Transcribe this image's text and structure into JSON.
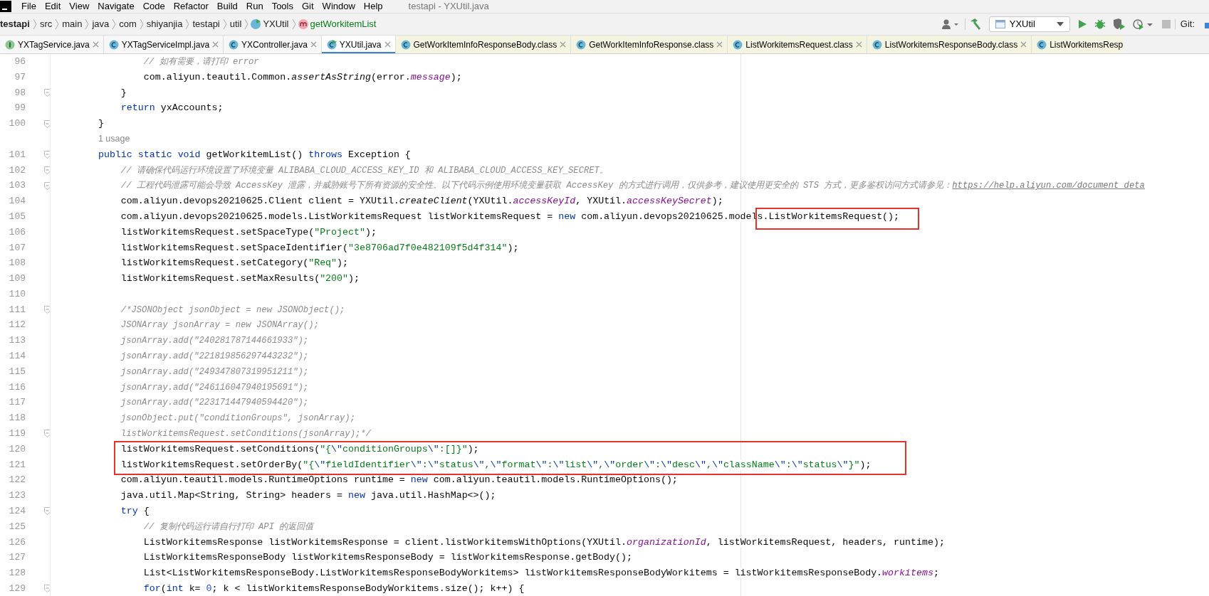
{
  "window": {
    "title": "testapi - YXUtil.java"
  },
  "menu": [
    "File",
    "Edit",
    "View",
    "Navigate",
    "Code",
    "Refactor",
    "Build",
    "Run",
    "Tools",
    "Git",
    "Window",
    "Help"
  ],
  "breadcrumbs": [
    {
      "label": "testapi",
      "kind": "project"
    },
    {
      "label": "src",
      "kind": "folder"
    },
    {
      "label": "main",
      "kind": "folder"
    },
    {
      "label": "java",
      "kind": "folder"
    },
    {
      "label": "com",
      "kind": "folder"
    },
    {
      "label": "shiyanjia",
      "kind": "folder"
    },
    {
      "label": "testapi",
      "kind": "folder"
    },
    {
      "label": "util",
      "kind": "folder"
    },
    {
      "label": "YXUtil",
      "kind": "class"
    },
    {
      "label": "getWorkitemList",
      "kind": "method"
    }
  ],
  "toolbar": [
    {
      "kind": "user-menu"
    },
    {
      "kind": "build"
    },
    {
      "kind": "run-config",
      "label": "YXUtil"
    },
    {
      "kind": "run"
    },
    {
      "kind": "debug"
    },
    {
      "kind": "coverage"
    },
    {
      "kind": "profile"
    },
    {
      "kind": "stop"
    },
    {
      "kind": "label",
      "label": "Git:"
    },
    {
      "kind": "git-update"
    }
  ],
  "tabs": [
    {
      "label": "YXTagService.java",
      "kind": "interface",
      "library": false,
      "selected": false,
      "closable": true
    },
    {
      "label": "YXTagServiceImpl.java",
      "kind": "class",
      "library": false,
      "selected": false,
      "closable": true
    },
    {
      "label": "YXController.java",
      "kind": "class",
      "library": false,
      "selected": false,
      "closable": true
    },
    {
      "label": "YXUtil.java",
      "kind": "runnable-class",
      "library": false,
      "selected": true,
      "closable": true
    },
    {
      "label": "GetWorkItemInfoResponseBody.class",
      "kind": "class",
      "library": true,
      "selected": false,
      "closable": true
    },
    {
      "label": "GetWorkItemInfoResponse.class",
      "kind": "class",
      "library": true,
      "selected": false,
      "closable": true
    },
    {
      "label": "ListWorkitemsRequest.class",
      "kind": "class",
      "library": true,
      "selected": false,
      "closable": true
    },
    {
      "label": "ListWorkitemsResponseBody.class",
      "kind": "class",
      "library": true,
      "selected": false,
      "closable": true
    },
    {
      "label": "ListWorkitemsResp",
      "kind": "class",
      "library": true,
      "selected": false,
      "closable": false
    }
  ],
  "editor": {
    "lines": [
      {
        "kind": "code",
        "number": "96",
        "fold": false,
        "boxed": false,
        "tokens": [
          {
            "kind": "comment",
            "text": "            // 如有需要，请打印 error"
          }
        ]
      },
      {
        "kind": "code",
        "number": "97",
        "fold": false,
        "boxed": false,
        "tokens": [
          {
            "kind": "plain",
            "text": "            com.aliyun.teautil.Common."
          },
          {
            "kind": "static-call",
            "text": "assertAsString"
          },
          {
            "kind": "plain",
            "text": "(error."
          },
          {
            "kind": "field",
            "text": "message"
          },
          {
            "kind": "plain",
            "text": ");"
          }
        ]
      },
      {
        "kind": "code",
        "number": "98",
        "fold": true,
        "boxed": false,
        "tokens": [
          {
            "kind": "plain",
            "text": "        }"
          }
        ]
      },
      {
        "kind": "code",
        "number": "99",
        "fold": false,
        "boxed": false,
        "tokens": [
          {
            "kind": "keyword",
            "text": "        return"
          },
          {
            "kind": "plain",
            "text": " yxAccounts;"
          }
        ]
      },
      {
        "kind": "code",
        "number": "100",
        "fold": true,
        "boxed": false,
        "tokens": [
          {
            "kind": "plain",
            "text": "    }"
          }
        ]
      },
      {
        "kind": "hint",
        "text": "    1 usage"
      },
      {
        "kind": "code",
        "number": "101",
        "fold": true,
        "boxed": false,
        "tokens": [
          {
            "kind": "keyword",
            "text": "    public static void"
          },
          {
            "kind": "plain",
            "text": " getWorkitemList() "
          },
          {
            "kind": "keyword",
            "text": "throws"
          },
          {
            "kind": "plain",
            "text": " Exception {"
          }
        ]
      },
      {
        "kind": "code",
        "number": "102",
        "fold": true,
        "boxed": false,
        "tokens": [
          {
            "kind": "comment",
            "text": "        // 请确保代码运行环境设置了环境变量 ALIBABA_CLOUD_ACCESS_KEY_ID 和 ALIBABA_CLOUD_ACCESS_KEY_SECRET。"
          }
        ]
      },
      {
        "kind": "code",
        "number": "103",
        "fold": true,
        "boxed": false,
        "tokens": [
          {
            "kind": "comment",
            "text": "        // 工程代码泄露可能会导致 AccessKey 泄露，并威胁账号下所有资源的安全性。以下代码示例使用环境变量获取 AccessKey 的方式进行调用，仅供参考，建议使用更安全的 STS 方式，更多鉴权访问方式请参见："
          },
          {
            "kind": "link",
            "text": "https://help.aliyun.com/document_deta"
          }
        ]
      },
      {
        "kind": "code",
        "number": "104",
        "fold": false,
        "boxed": false,
        "tokens": [
          {
            "kind": "plain",
            "text": "        com.aliyun.devops20210625.Client client = YXUtil."
          },
          {
            "kind": "static-call",
            "text": "createClient"
          },
          {
            "kind": "plain",
            "text": "(YXUtil."
          },
          {
            "kind": "field",
            "text": "accessKeyId"
          },
          {
            "kind": "plain",
            "text": ", YXUtil."
          },
          {
            "kind": "field",
            "text": "accessKeySecret"
          },
          {
            "kind": "plain",
            "text": ");"
          }
        ]
      },
      {
        "kind": "code",
        "number": "105",
        "fold": false,
        "boxed": false,
        "tokens": [
          {
            "kind": "plain",
            "text": "        com.aliyun.devops20210625.models.ListWorkitemsRequest listWorkitemsRequest = ",
            "boxed": false
          },
          {
            "kind": "keyword",
            "text": "new",
            "boxed": false
          },
          {
            "kind": "plain",
            "text": " com.aliyun.devops20210625.model",
            "boxed": false
          },
          {
            "kind": "plain",
            "text": "s.ListWorkitemsRequest();",
            "boxed": true
          }
        ]
      },
      {
        "kind": "code",
        "number": "106",
        "fold": false,
        "boxed": false,
        "tokens": [
          {
            "kind": "plain",
            "text": "        listWorkitemsRequest.setSpaceType("
          },
          {
            "kind": "string",
            "text": "\"Project\""
          },
          {
            "kind": "plain",
            "text": ");"
          }
        ]
      },
      {
        "kind": "code",
        "number": "107",
        "fold": false,
        "boxed": false,
        "tokens": [
          {
            "kind": "plain",
            "text": "        listWorkitemsRequest.setSpaceIdentifier("
          },
          {
            "kind": "string",
            "text": "\"3e8706ad7f0e482109f5d4f314\""
          },
          {
            "kind": "plain",
            "text": ");"
          }
        ]
      },
      {
        "kind": "code",
        "number": "108",
        "fold": false,
        "boxed": false,
        "tokens": [
          {
            "kind": "plain",
            "text": "        listWorkitemsRequest.setCategory("
          },
          {
            "kind": "string",
            "text": "\"Req\""
          },
          {
            "kind": "plain",
            "text": ");"
          }
        ]
      },
      {
        "kind": "code",
        "number": "109",
        "fold": false,
        "boxed": false,
        "tokens": [
          {
            "kind": "plain",
            "text": "        listWorkitemsRequest.setMaxResults("
          },
          {
            "kind": "string",
            "text": "\"200\""
          },
          {
            "kind": "plain",
            "text": ");"
          }
        ]
      },
      {
        "kind": "code",
        "number": "110",
        "fold": false,
        "boxed": false
      },
      {
        "kind": "code",
        "number": "111",
        "fold": true,
        "boxed": false,
        "tokens": [
          {
            "kind": "comment",
            "text": "        /*JSONObject jsonObject = new JSONObject();"
          }
        ]
      },
      {
        "kind": "code",
        "number": "112",
        "fold": false,
        "boxed": false,
        "tokens": [
          {
            "kind": "comment",
            "text": "        JSONArray jsonArray = new JSONArray();"
          }
        ]
      },
      {
        "kind": "code",
        "number": "113",
        "fold": false,
        "boxed": false,
        "tokens": [
          {
            "kind": "comment",
            "text": "        jsonArray.add(\"240281787144661933\");"
          }
        ]
      },
      {
        "kind": "code",
        "number": "114",
        "fold": false,
        "boxed": false,
        "tokens": [
          {
            "kind": "comment",
            "text": "        jsonArray.add(\"221819856297443232\");"
          }
        ]
      },
      {
        "kind": "code",
        "number": "115",
        "fold": false,
        "boxed": false,
        "tokens": [
          {
            "kind": "comment",
            "text": "        jsonArray.add(\"249347807319951211\");"
          }
        ]
      },
      {
        "kind": "code",
        "number": "116",
        "fold": false,
        "boxed": false,
        "tokens": [
          {
            "kind": "comment",
            "text": "        jsonArray.add(\"246116047940195691\");"
          }
        ]
      },
      {
        "kind": "code",
        "number": "117",
        "fold": false,
        "boxed": false,
        "tokens": [
          {
            "kind": "comment",
            "text": "        jsonArray.add(\"223171447940594420\");"
          }
        ]
      },
      {
        "kind": "code",
        "number": "118",
        "fold": false,
        "boxed": false,
        "tokens": [
          {
            "kind": "comment",
            "text": "        jsonObject.put(\"conditionGroups\", jsonArray);"
          }
        ]
      },
      {
        "kind": "code",
        "number": "119",
        "fold": true,
        "boxed": false,
        "tokens": [
          {
            "kind": "comment",
            "text": "        listWorkitemsRequest.setConditions(jsonArray);*/"
          }
        ]
      },
      {
        "kind": "code",
        "number": "120",
        "fold": false,
        "boxed": true,
        "tokens": [
          {
            "kind": "plain",
            "text": "        listWorkitemsRequest.setConditions("
          },
          {
            "kind": "string",
            "text": "\"{"
          },
          {
            "kind": "escape",
            "text": "\\\""
          },
          {
            "kind": "string",
            "text": "conditionGroups"
          },
          {
            "kind": "escape",
            "text": "\\\""
          },
          {
            "kind": "string",
            "text": ":[]}\""
          },
          {
            "kind": "plain",
            "text": ");"
          }
        ]
      },
      {
        "kind": "code",
        "number": "121",
        "fold": false,
        "boxed": true,
        "tokens": [
          {
            "kind": "plain",
            "text": "        listWorkitemsRequest.setOrderBy("
          },
          {
            "kind": "string",
            "text": "\"{"
          },
          {
            "kind": "escape",
            "text": "\\\""
          },
          {
            "kind": "string",
            "text": "fieldIdentifier"
          },
          {
            "kind": "escape",
            "text": "\\\""
          },
          {
            "kind": "string",
            "text": ":"
          },
          {
            "kind": "escape",
            "text": "\\\""
          },
          {
            "kind": "string",
            "text": "status"
          },
          {
            "kind": "escape",
            "text": "\\\""
          },
          {
            "kind": "string",
            "text": ","
          },
          {
            "kind": "escape",
            "text": "\\\""
          },
          {
            "kind": "string",
            "text": "format"
          },
          {
            "kind": "escape",
            "text": "\\\""
          },
          {
            "kind": "string",
            "text": ":"
          },
          {
            "kind": "escape",
            "text": "\\\""
          },
          {
            "kind": "string",
            "text": "list"
          },
          {
            "kind": "escape",
            "text": "\\\""
          },
          {
            "kind": "string",
            "text": ","
          },
          {
            "kind": "escape",
            "text": "\\\""
          },
          {
            "kind": "string",
            "text": "order"
          },
          {
            "kind": "escape",
            "text": "\\\""
          },
          {
            "kind": "string",
            "text": ":"
          },
          {
            "kind": "escape",
            "text": "\\\""
          },
          {
            "kind": "string",
            "text": "desc"
          },
          {
            "kind": "escape",
            "text": "\\\""
          },
          {
            "kind": "string",
            "text": ","
          },
          {
            "kind": "escape",
            "text": "\\\""
          },
          {
            "kind": "string",
            "text": "className"
          },
          {
            "kind": "escape",
            "text": "\\\""
          },
          {
            "kind": "string",
            "text": ":"
          },
          {
            "kind": "escape",
            "text": "\\\""
          },
          {
            "kind": "string",
            "text": "status"
          },
          {
            "kind": "escape",
            "text": "\\\""
          },
          {
            "kind": "string",
            "text": "}\""
          },
          {
            "kind": "plain",
            "text": ");"
          }
        ]
      },
      {
        "kind": "code",
        "number": "122",
        "fold": false,
        "boxed": false,
        "tokens": [
          {
            "kind": "plain",
            "text": "        com.aliyun.teautil.models.RuntimeOptions runtime = "
          },
          {
            "kind": "keyword",
            "text": "new"
          },
          {
            "kind": "plain",
            "text": " com.aliyun.teautil.models.RuntimeOptions();"
          }
        ]
      },
      {
        "kind": "code",
        "number": "123",
        "fold": false,
        "boxed": false,
        "tokens": [
          {
            "kind": "plain",
            "text": "        java.util.Map<String, String> headers = "
          },
          {
            "kind": "keyword",
            "text": "new"
          },
          {
            "kind": "plain",
            "text": " java.util.HashMap<>();"
          }
        ]
      },
      {
        "kind": "code",
        "number": "124",
        "fold": true,
        "boxed": false,
        "tokens": [
          {
            "kind": "keyword",
            "text": "        try"
          },
          {
            "kind": "plain",
            "text": " {"
          }
        ]
      },
      {
        "kind": "code",
        "number": "125",
        "fold": false,
        "boxed": false,
        "tokens": [
          {
            "kind": "comment",
            "text": "            // 复制代码运行请自行打印 API 的返回值"
          }
        ]
      },
      {
        "kind": "code",
        "number": "126",
        "fold": false,
        "boxed": false,
        "tokens": [
          {
            "kind": "plain",
            "text": "            ListWorkitemsResponse listWorkitemsResponse = client.listWorkitemsWithOptions(YXUtil."
          },
          {
            "kind": "field",
            "text": "organizationId"
          },
          {
            "kind": "plain",
            "text": ", listWorkitemsRequest, headers, runtime);"
          }
        ]
      },
      {
        "kind": "code",
        "number": "127",
        "fold": false,
        "boxed": false,
        "tokens": [
          {
            "kind": "plain",
            "text": "            ListWorkitemsResponseBody listWorkitemsResponseBody = listWorkitemsResponse.getBody();"
          }
        ]
      },
      {
        "kind": "code",
        "number": "128",
        "fold": false,
        "boxed": false,
        "tokens": [
          {
            "kind": "plain",
            "text": "            List<ListWorkitemsResponseBody.ListWorkitemsResponseBodyWorkitems> listWorkitemsResponseBodyWorkitems = listWorkitemsResponseBody."
          },
          {
            "kind": "field",
            "text": "workitems"
          },
          {
            "kind": "plain",
            "text": ";"
          }
        ]
      },
      {
        "kind": "code",
        "number": "129",
        "fold": true,
        "boxed": false,
        "tokens": [
          {
            "kind": "keyword",
            "text": "            for"
          },
          {
            "kind": "plain",
            "text": "("
          },
          {
            "kind": "keyword",
            "text": "int"
          },
          {
            "kind": "plain",
            "text": " k= "
          },
          {
            "kind": "number",
            "text": "0"
          },
          {
            "kind": "plain",
            "text": "; k < listWorkitemsResponseBodyWorkitems.size(); k++) {"
          }
        ]
      }
    ]
  }
}
